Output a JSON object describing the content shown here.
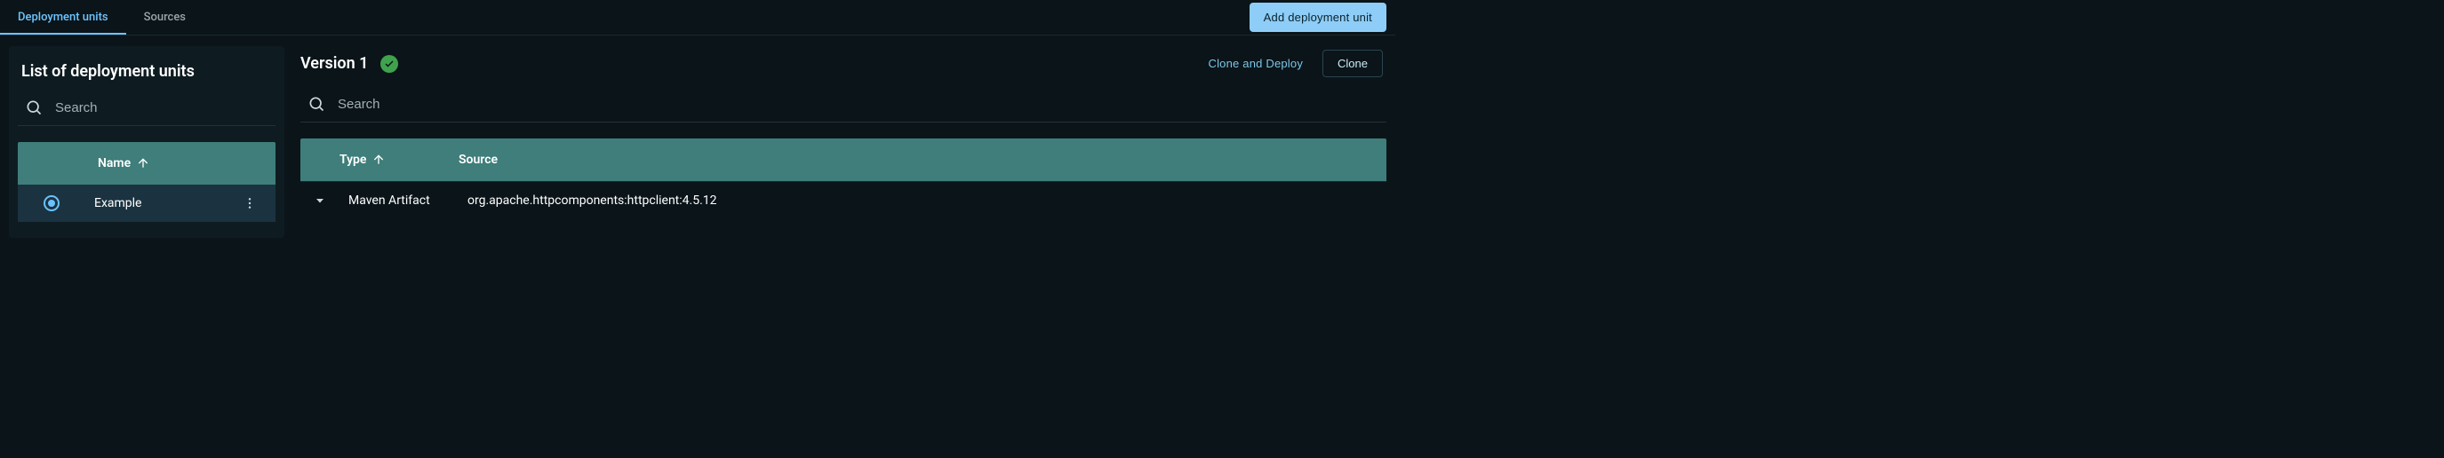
{
  "tabs": {
    "deployment_units": "Deployment units",
    "sources": "Sources"
  },
  "actions": {
    "add_deployment_unit": "Add deployment unit",
    "clone_and_deploy": "Clone and Deploy",
    "clone": "Clone"
  },
  "sidepanel": {
    "title": "List of deployment units",
    "search_placeholder": "Search",
    "columns": {
      "name": "Name"
    },
    "rows": [
      {
        "name": "Example"
      }
    ]
  },
  "mainpanel": {
    "version_title": "Version 1",
    "search_placeholder": "Search",
    "columns": {
      "type": "Type",
      "source": "Source"
    },
    "rows": [
      {
        "type": "Maven Artifact",
        "source": "org.apache.httpcomponents:httpclient:4.5.12"
      }
    ]
  }
}
